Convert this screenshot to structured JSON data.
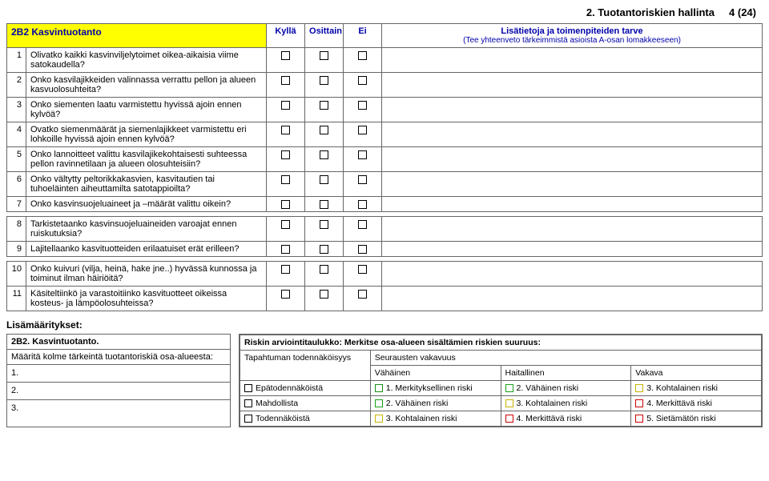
{
  "page_header": {
    "title": "2. Tuotantoriskien hallinta",
    "page": "4 (24)"
  },
  "section": {
    "code": "2B2",
    "title": "Kasvintuotanto",
    "cols": {
      "yes": "Kyllä",
      "partly": "Osittain",
      "no": "Ei"
    },
    "info_title": "Lisätietoja ja toimenpiteiden tarve",
    "info_sub": "(Tee yhteenveto tärkeimmistä asioista A-osan lomakkeeseen)"
  },
  "rows": [
    {
      "n": "1",
      "q": "Olivatko kaikki kasvinviljelytoimet oikea-aikaisia viime satokaudella?"
    },
    {
      "n": "2",
      "q": "Onko kasvilajikkeiden valinnassa verrattu pellon ja alueen kasvuolosuhteita?"
    },
    {
      "n": "3",
      "q": "Onko siementen laatu varmistettu hyvissä ajoin ennen kylvöä?"
    },
    {
      "n": "4",
      "q": "Ovatko siemenmäärät ja siemenlajikkeet varmistettu eri lohkoille hyvissä ajoin ennen kylvöä?"
    },
    {
      "n": "5",
      "q": "Onko lannoitteet valittu kasvilajikekohtaisesti suhteessa pellon ravinnetilaan ja alueen olosuhteisiin?"
    },
    {
      "n": "6",
      "q": "Onko vältytty peltorikkakasvien, kasvitautien tai tuhoeläinten aiheuttamilta satotappioilta?"
    },
    {
      "n": "7",
      "q": "Onko kasvinsuojeluaineet ja –määrät valittu oikein?"
    },
    {
      "n": "8",
      "q": "Tarkistetaanko kasvinsuojeluaineiden varoajat ennen ruiskutuksia?"
    },
    {
      "n": "9",
      "q": "Lajitellaanko kasvituotteiden erilaatuiset erät erilleen?"
    },
    {
      "n": "10",
      "q": "Onko kuivuri (vilja, heinä, hake jne..) hyvässä kunnossa ja toiminut ilman häiriöitä?"
    },
    {
      "n": "11",
      "q": "Käsiteltiinkö ja varastoitiinko kasvituotteet oikeissa kosteus- ja lämpöolosuhteissa?"
    }
  ],
  "spec_label": "Lisämääritykset:",
  "lower_left": {
    "title": "2B2. Kasvintuotanto.",
    "subtitle": "Määritä kolme tärkeintä tuotantoriskiä osa-alueesta:",
    "nums": [
      "1.",
      "2.",
      "3."
    ]
  },
  "risk": {
    "head": "Riskin arviointitaulukko: Merkitse osa-alueen sisältämien riskien suuruus:",
    "prob_label": "Tapahtuman todennäköisyys",
    "sev_label": "Seurausten vakavuus",
    "sev_cols": [
      "Vähäinen",
      "Haitallinen",
      "Vakava"
    ],
    "prob_rows": [
      "Epätodennäköistä",
      "Mahdollista",
      "Todennäköistä"
    ],
    "cells": [
      [
        "1. Merkityksellinen riski",
        "2. Vähäinen riski",
        "3. Kohtalainen riski"
      ],
      [
        "2. Vähäinen riski",
        "3. Kohtalainen riski",
        "4. Merkittävä riski"
      ],
      [
        "3. Kohtalainen riski",
        "4. Merkittävä riski",
        "5. Sietämätön riski"
      ]
    ],
    "colors": [
      [
        "c1",
        "c2",
        "c3"
      ],
      [
        "c2",
        "c3",
        "c4"
      ],
      [
        "c3",
        "c4",
        "c5"
      ]
    ]
  }
}
